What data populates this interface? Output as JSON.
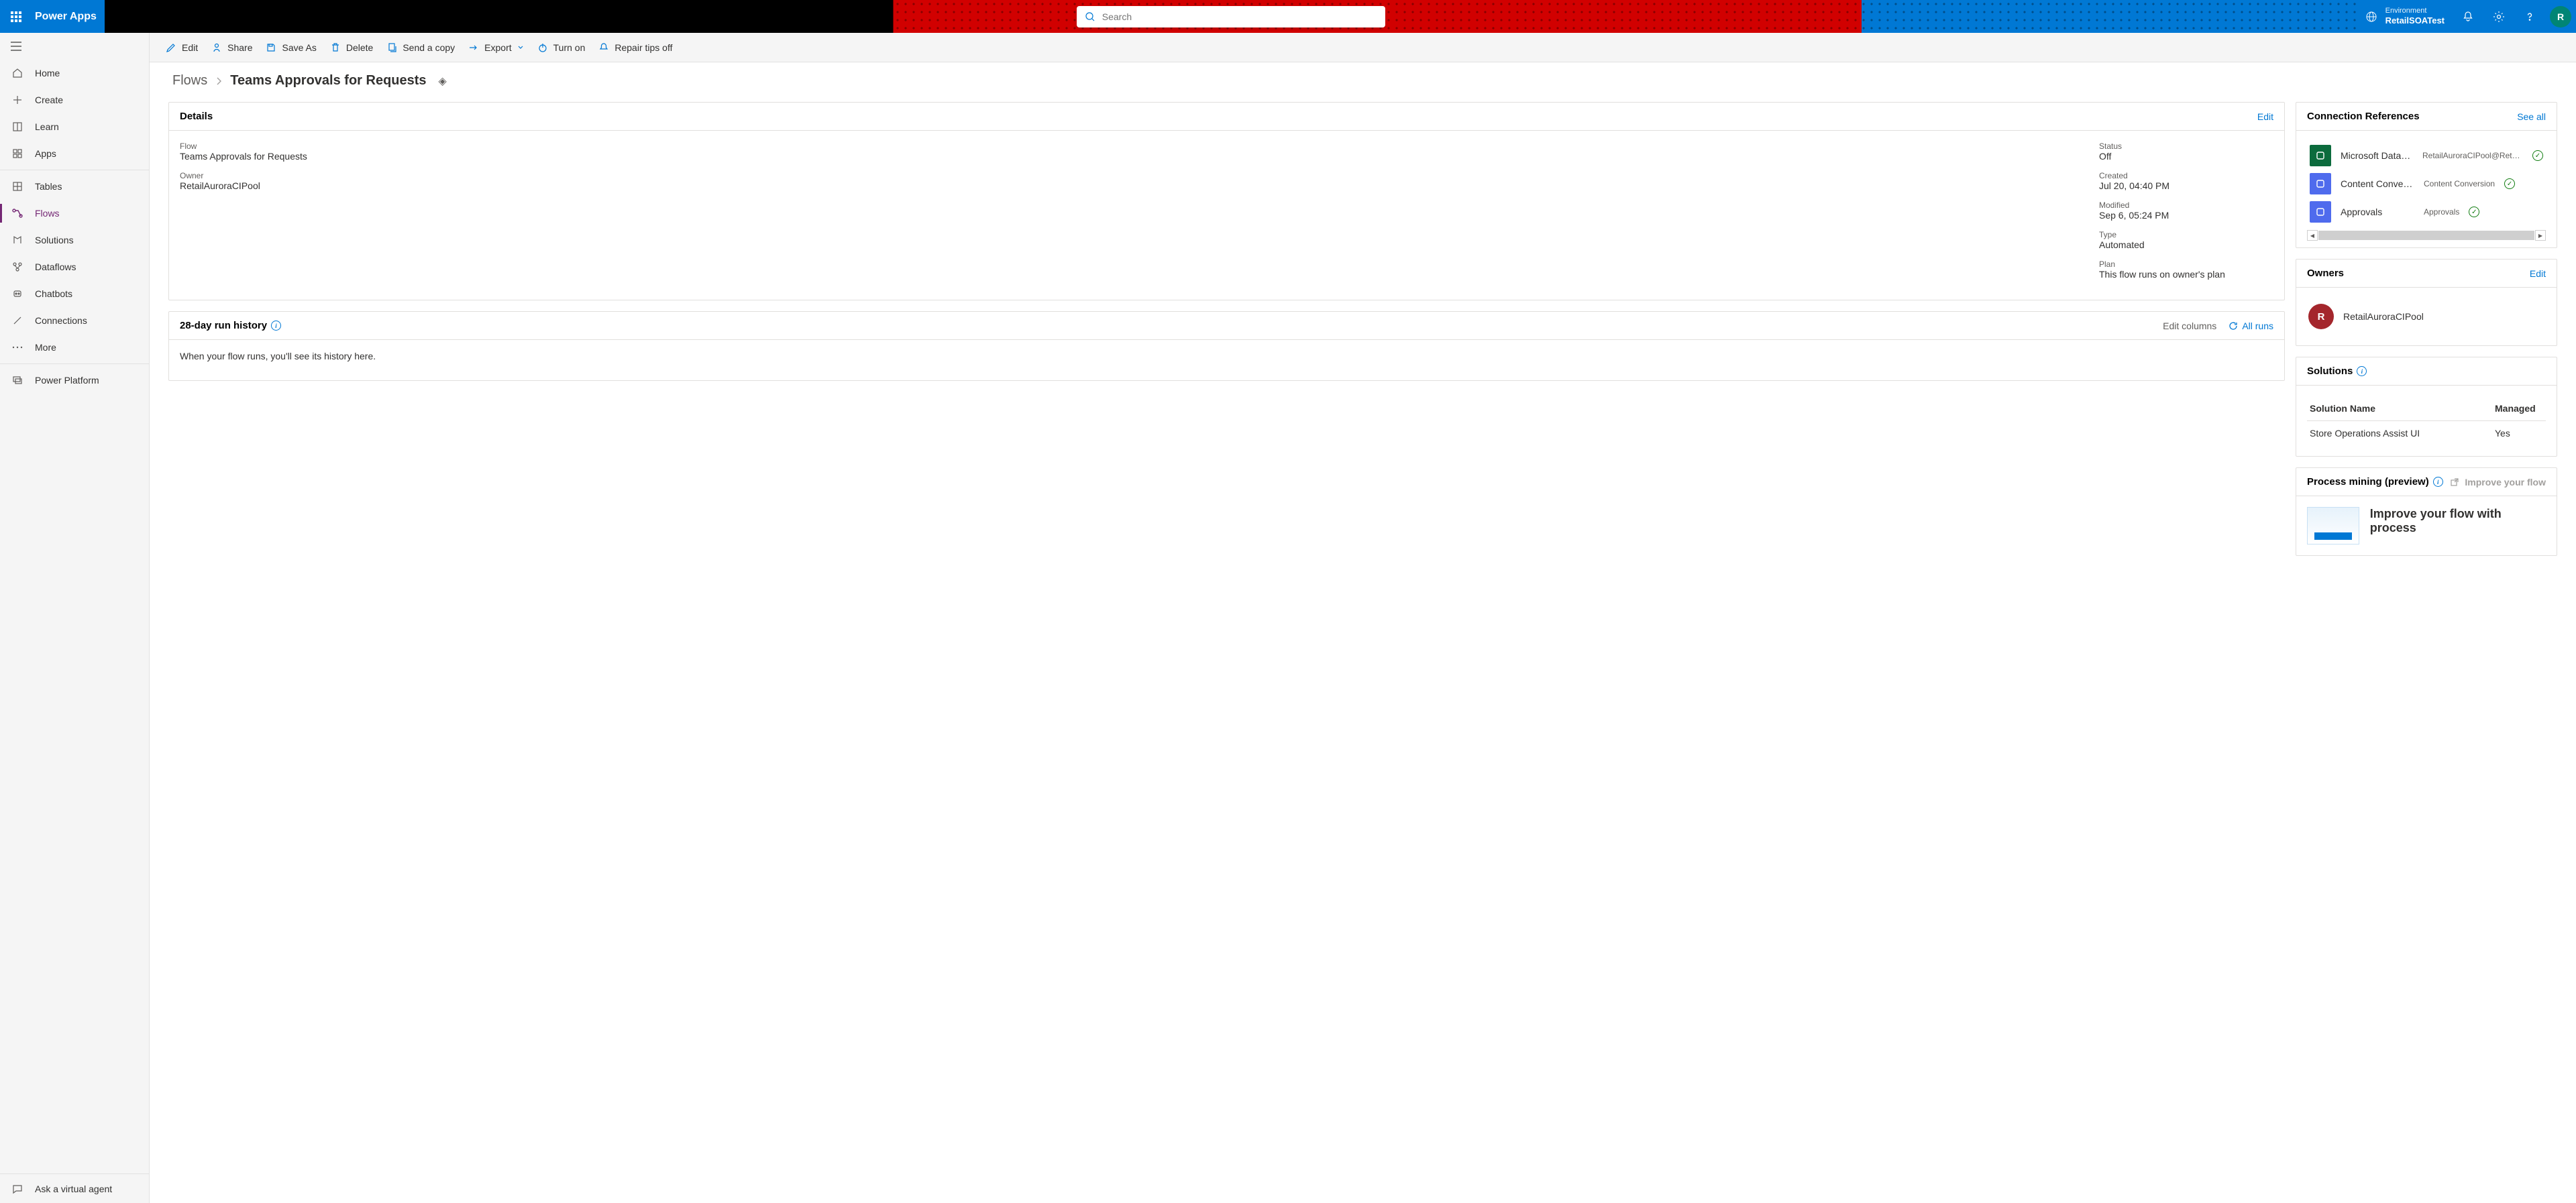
{
  "header": {
    "brand": "Power Apps",
    "search_placeholder": "Search",
    "env_label": "Environment",
    "env_value": "RetailSOATest",
    "avatar_letter": "R"
  },
  "sidebar": {
    "items": [
      {
        "label": "Home"
      },
      {
        "label": "Create"
      },
      {
        "label": "Learn"
      },
      {
        "label": "Apps"
      },
      {
        "label": "Tables"
      },
      {
        "label": "Flows"
      },
      {
        "label": "Solutions"
      },
      {
        "label": "Dataflows"
      },
      {
        "label": "Chatbots"
      },
      {
        "label": "Connections"
      },
      {
        "label": "More"
      },
      {
        "label": "Power Platform"
      }
    ],
    "ask": "Ask a virtual agent"
  },
  "actions": {
    "edit": "Edit",
    "share": "Share",
    "save_as": "Save As",
    "delete": "Delete",
    "send_copy": "Send a copy",
    "export": "Export",
    "turn_on": "Turn on",
    "repair": "Repair tips off"
  },
  "breadcrumb": {
    "parent": "Flows",
    "current": "Teams Approvals for Requests"
  },
  "details": {
    "title": "Details",
    "edit": "Edit",
    "flow_lbl": "Flow",
    "flow_val": "Teams Approvals for Requests",
    "owner_lbl": "Owner",
    "owner_val": "RetailAuroraCIPool",
    "status_lbl": "Status",
    "status_val": "Off",
    "created_lbl": "Created",
    "created_val": "Jul 20, 04:40 PM",
    "modified_lbl": "Modified",
    "modified_val": "Sep 6, 05:24 PM",
    "type_lbl": "Type",
    "type_val": "Automated",
    "plan_lbl": "Plan",
    "plan_val": "This flow runs on owner's plan"
  },
  "history": {
    "title": "28-day run history",
    "edit_cols": "Edit columns",
    "all_runs": "All runs",
    "empty": "When your flow runs, you'll see its history here."
  },
  "connections": {
    "title": "Connection References",
    "see_all": "See all",
    "items": [
      {
        "name": "Microsoft Dataverse",
        "sub": "RetailAuroraCIPool@RetailCPO",
        "bg": "#0c6b3d"
      },
      {
        "name": "Content Conversion",
        "sub": "Content Conversion",
        "bg": "#4f6bed"
      },
      {
        "name": "Approvals",
        "sub": "Approvals",
        "bg": "#4f6bed"
      }
    ]
  },
  "owners": {
    "title": "Owners",
    "edit": "Edit",
    "name": "RetailAuroraCIPool",
    "initial": "R"
  },
  "solutions": {
    "title": "Solutions",
    "col_name": "Solution Name",
    "col_managed": "Managed",
    "row_name": "Store Operations Assist UI",
    "row_managed": "Yes"
  },
  "process_mining": {
    "title": "Process mining (preview)",
    "improve_link": "Improve your flow",
    "headline": "Improve your flow with process"
  }
}
